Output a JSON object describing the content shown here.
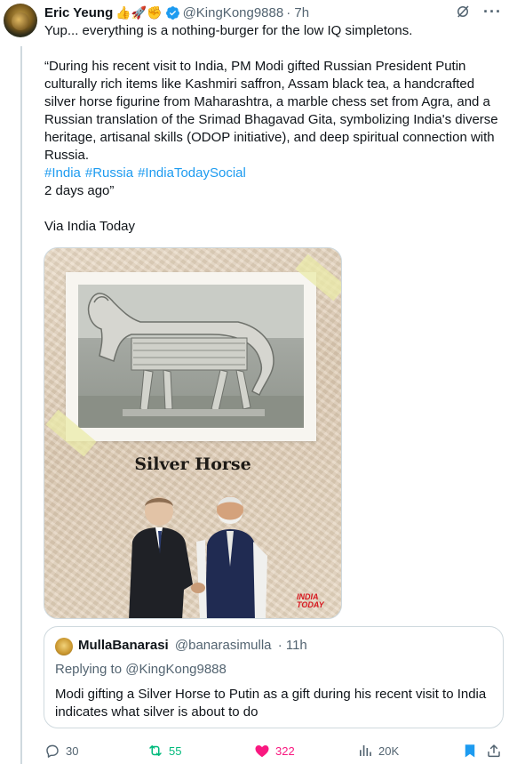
{
  "tweet": {
    "author_name": "Eric Yeung",
    "author_emojis": "👍🚀✊",
    "author_handle": "@KingKong9888",
    "time": "· 7h",
    "text_main": "Yup... everything is a nothing-burger for the low IQ simpletons.",
    "text_quote": "“During his recent visit to India, PM Modi gifted Russian President Putin culturally rich items like Kashmiri saffron, Assam black tea, a handcrafted silver horse figurine from Maharashtra, a marble chess set from Agra, and a Russian translation of the Srimad Bhagavad Gita, symbolizing India's diverse heritage, artisanal skills (ODOP initiative), and deep spiritual connection with Russia.",
    "hashtags": [
      "#India",
      "#Russia",
      "#IndiaTodaySocial"
    ],
    "text_days": "2 days ago”",
    "text_via": "Via India Today",
    "media": {
      "caption": "Silver Horse",
      "brand_line1": "INDIA",
      "brand_line2": "TODAY"
    }
  },
  "quoted": {
    "author_name": "MullaBanarasi",
    "author_handle": "@banarasimulla",
    "time": "· 11h",
    "replying_prefix": "Replying to ",
    "replying_to": "@KingKong9888",
    "text": "Modi gifting a Silver Horse to Putin as a gift during his recent visit to India indicates what silver is about to do"
  },
  "actions": {
    "replies": "30",
    "retweets": "55",
    "likes": "322",
    "views": "20K"
  },
  "colors": {
    "link": "#1d9bf0",
    "retweet": "#00ba7c",
    "like": "#f91880",
    "bookmark": "#1d9bf0"
  },
  "icons": [
    "grok-icon",
    "more-icon",
    "verified-badge-icon",
    "reply-icon",
    "retweet-icon",
    "like-icon",
    "views-icon",
    "bookmark-icon",
    "share-icon"
  ]
}
